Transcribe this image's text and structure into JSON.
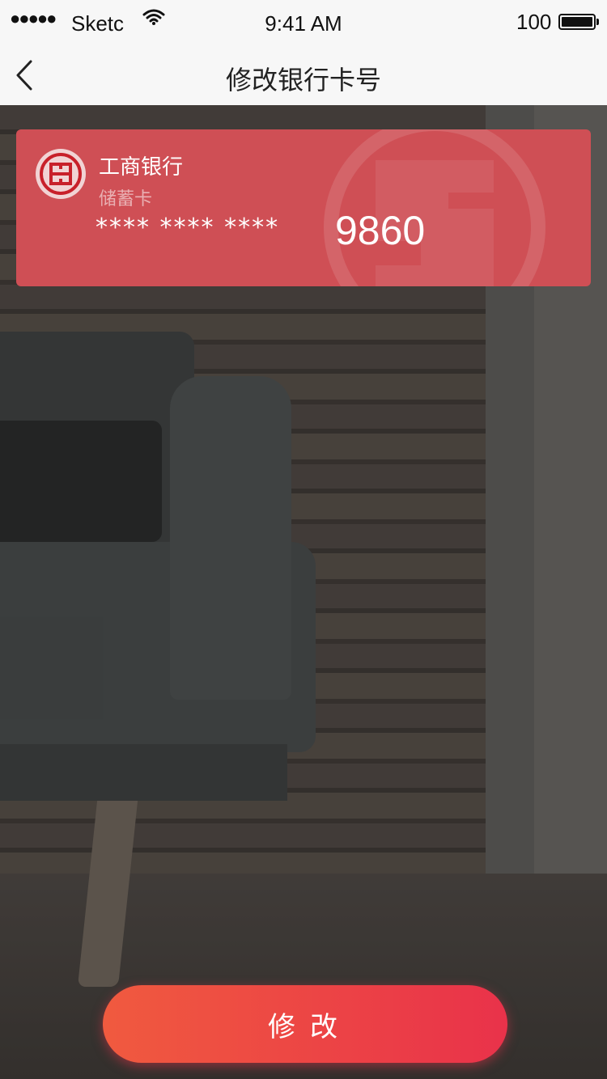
{
  "status_bar": {
    "signal": "●●●●●",
    "carrier": "Sketc",
    "time": "9:41 AM",
    "battery": "100"
  },
  "nav": {
    "back_icon": "chevron-left-icon",
    "title": "修改银行卡号"
  },
  "card": {
    "bank_name": "工商银行",
    "card_type": "储蓄卡",
    "masked": "**** **** ****",
    "last_four": "9860",
    "color": "#cf4f55"
  },
  "action": {
    "label": "修改"
  },
  "colors": {
    "button_start": "#f05a3f",
    "button_end": "#e9324a"
  }
}
